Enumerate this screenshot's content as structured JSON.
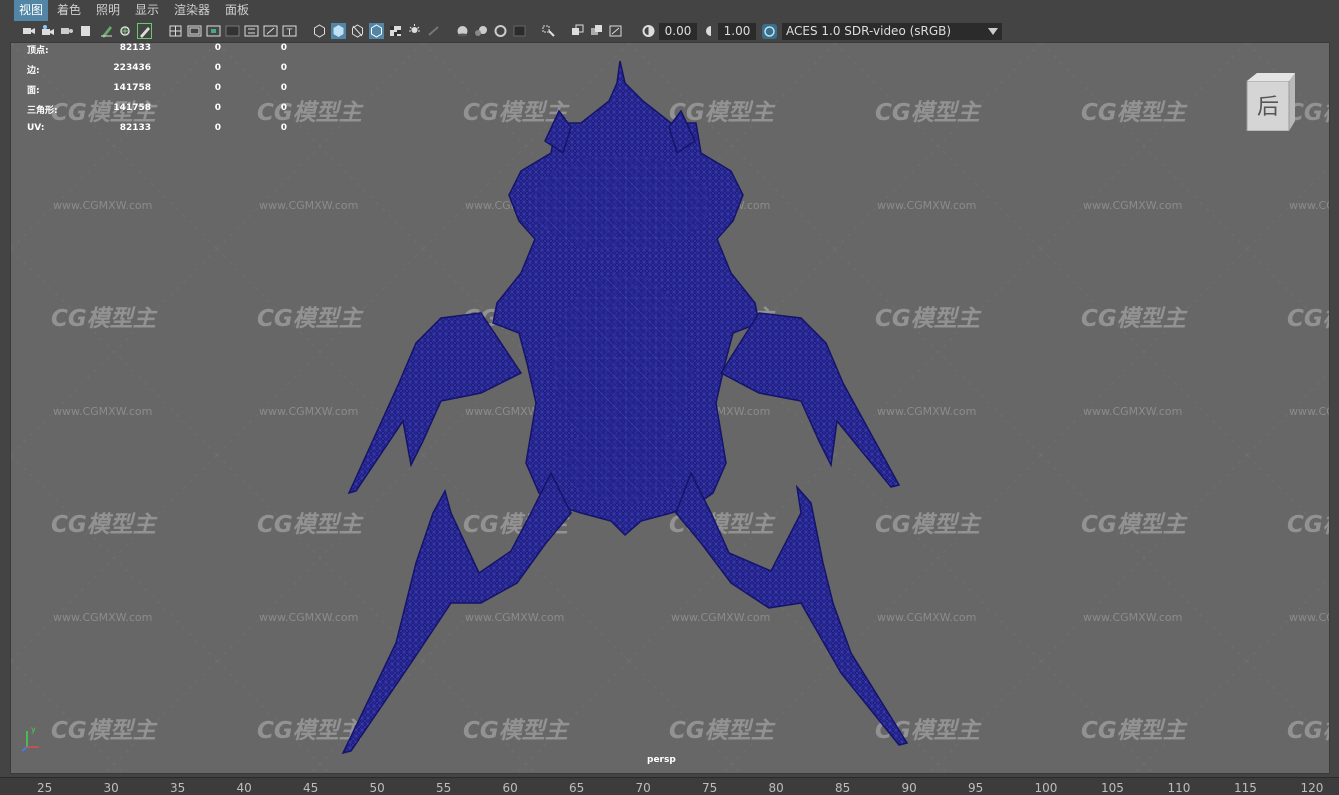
{
  "menu": [
    {
      "label": "视图",
      "active": true
    },
    {
      "label": "着色"
    },
    {
      "label": "照明"
    },
    {
      "label": "显示"
    },
    {
      "label": "渲染器"
    },
    {
      "label": "面板"
    }
  ],
  "toolbar": {
    "exposure_value": "0.00",
    "gamma_value": "1.00",
    "color_management": "ACES 1.0 SDR-video (sRGB)"
  },
  "hud": {
    "rows": [
      {
        "label": "顶点:",
        "v1": "82133",
        "v2": "0",
        "v3": "0"
      },
      {
        "label": "边:",
        "v1": "223436",
        "v2": "0",
        "v3": "0"
      },
      {
        "label": "面:",
        "v1": "141758",
        "v2": "0",
        "v3": "0"
      },
      {
        "label": "三角形:",
        "v1": "141758",
        "v2": "0",
        "v3": "0"
      },
      {
        "label": "UV:",
        "v1": "82133",
        "v2": "0",
        "v3": "0"
      }
    ]
  },
  "viewport": {
    "camera": "persp",
    "viewcube_face": "后",
    "wireframe_color": "#1a1a8c",
    "background_color": "#676767",
    "watermark": "CG模型主",
    "watermark_url": "www.CGMXW.com"
  },
  "axis": {
    "x": "x",
    "y": "y",
    "z": "z"
  },
  "ruler": {
    "ticks": [
      "25",
      "30",
      "35",
      "40",
      "45",
      "50",
      "55",
      "60",
      "65",
      "70",
      "75",
      "80",
      "85",
      "90",
      "95",
      "100",
      "105",
      "110",
      "115",
      "120"
    ]
  }
}
